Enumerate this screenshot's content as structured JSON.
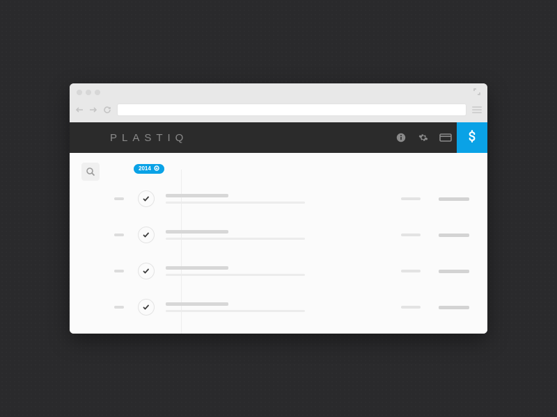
{
  "brand": "PLASTIQ",
  "colors": {
    "accent": "#0aa2e6",
    "header": "#2b2b2b"
  },
  "browser": {
    "address_value": ""
  },
  "header_icons": [
    "info-icon",
    "gear-icon",
    "card-icon"
  ],
  "pay_button": {
    "symbol": "$"
  },
  "timeline": {
    "year_badge": "2014",
    "items": [
      {
        "status": "done"
      },
      {
        "status": "done"
      },
      {
        "status": "done"
      },
      {
        "status": "done"
      }
    ]
  }
}
